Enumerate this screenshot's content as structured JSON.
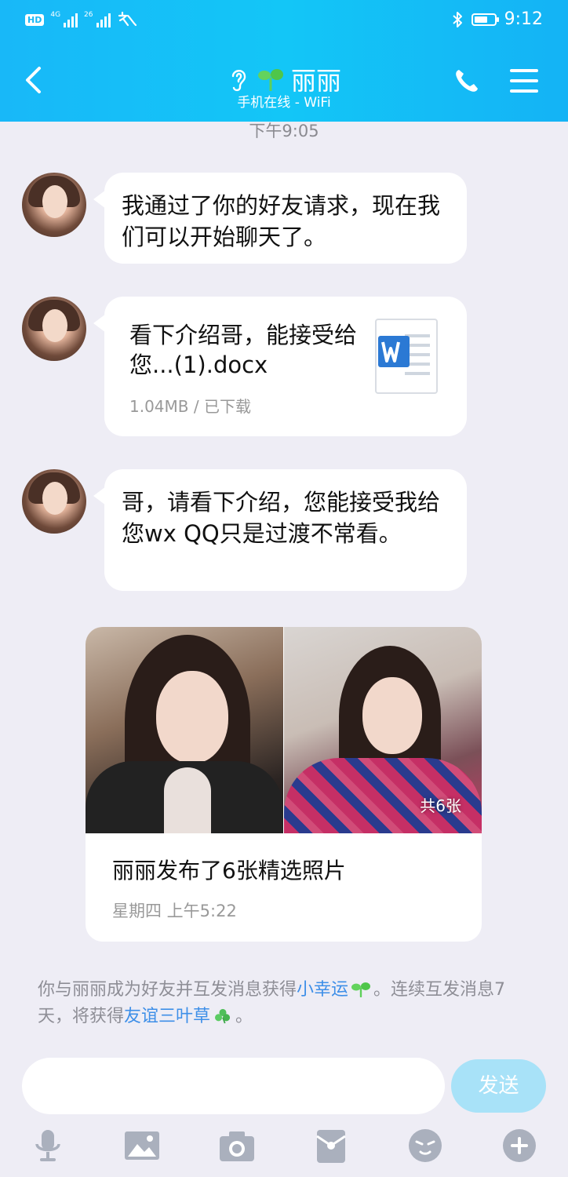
{
  "status_bar": {
    "hd": "HD",
    "sim1": "4G",
    "sim2": "26",
    "time": "9:12",
    "battery_level": 0.7
  },
  "header": {
    "contact_name": "丽丽",
    "status": "手机在线 - WiFi"
  },
  "chat": {
    "timestamp": "下午9:05",
    "messages": [
      {
        "type": "text",
        "text": "我通过了你的好友请求，现在我们可以开始聊天了。"
      },
      {
        "type": "file",
        "file_name": "看下介绍哥，能接受给您...(1).docx",
        "meta": "1.04MB / 已下载"
      },
      {
        "type": "text",
        "text": "哥，请看下介绍，您能接受我给您wx QQ只是过渡不常看。"
      }
    ],
    "photo_card": {
      "count": "共6张",
      "title": "丽丽发布了6张精选照片",
      "meta": "星期四 上午5:22"
    },
    "system_message": {
      "part1": "你与丽丽成为好友并互发消息获得",
      "link1": "小幸运",
      "part2": "。连续互发消息7天，将获得",
      "link2": "友谊三叶草",
      "part3": "。"
    }
  },
  "input": {
    "placeholder": "",
    "send_label": "发送"
  },
  "colors": {
    "header": "#18b8f8",
    "background": "#eeedf5",
    "link": "#3e8fe8",
    "send_button": "#a8e2f8"
  },
  "toolbar_icons": [
    "microphone-icon",
    "image-icon",
    "camera-icon",
    "red-packet-icon",
    "emoji-icon",
    "plus-icon"
  ]
}
